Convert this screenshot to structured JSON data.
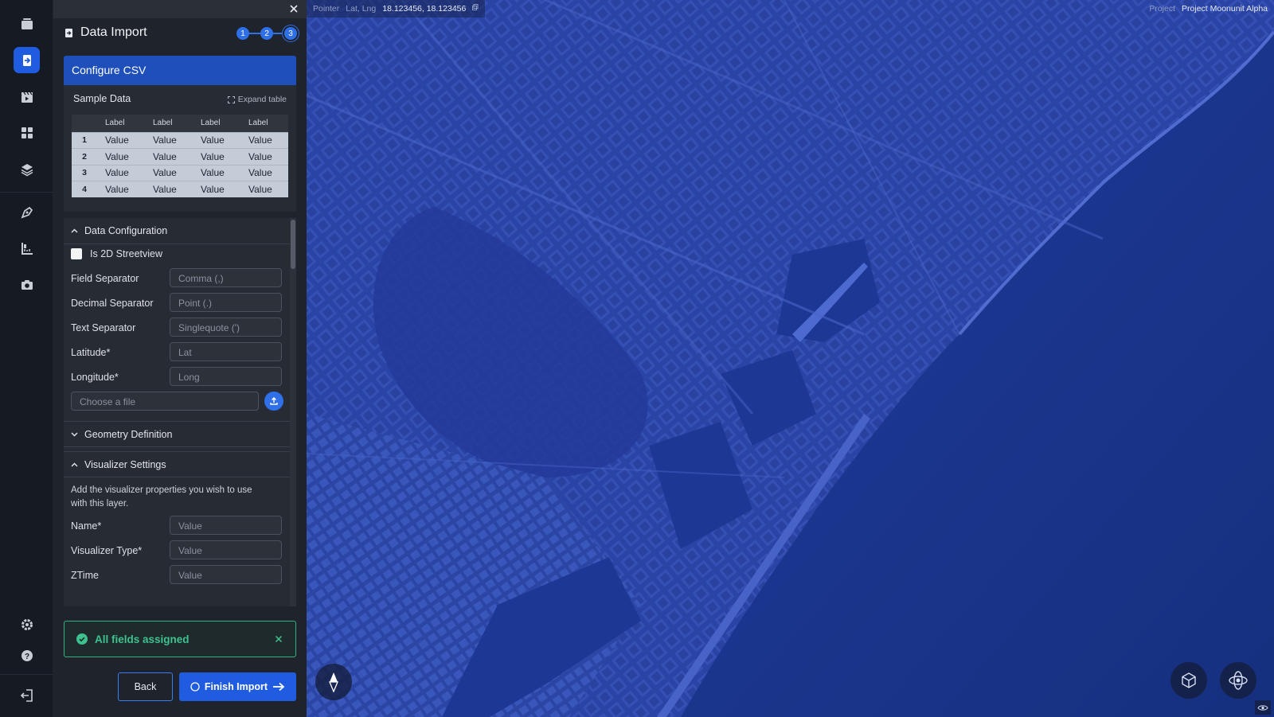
{
  "rail": {
    "items": [
      {
        "icon": "folder-stack-icon",
        "active": false
      },
      {
        "icon": "data-import-icon",
        "active": true
      },
      {
        "icon": "film-clapper-icon",
        "active": false
      },
      {
        "icon": "dashboard-grid-icon",
        "active": false
      },
      {
        "icon": "layers-icon",
        "active": false
      },
      {
        "icon": "pen-nib-icon",
        "active": false
      },
      {
        "icon": "ruler-measure-icon",
        "active": false
      },
      {
        "icon": "camera-icon",
        "active": false
      },
      {
        "icon": "gear-icon",
        "active": false
      },
      {
        "icon": "help-icon",
        "active": false
      },
      {
        "icon": "logout-icon",
        "active": false
      }
    ]
  },
  "panel": {
    "title": "Data Import",
    "steps": [
      "1",
      "2",
      "3"
    ],
    "current_step": "3",
    "configure_title": "Configure CSV",
    "sample": {
      "heading": "Sample Data",
      "expand_label": "Expand table",
      "columns": [
        "Label",
        "Label",
        "Label",
        "Label"
      ],
      "rows": [
        {
          "index": "1",
          "cells": [
            "Value",
            "Value",
            "Value",
            "Value"
          ]
        },
        {
          "index": "2",
          "cells": [
            "Value",
            "Value",
            "Value",
            "Value"
          ]
        },
        {
          "index": "3",
          "cells": [
            "Value",
            "Value",
            "Value",
            "Value"
          ]
        },
        {
          "index": "4",
          "cells": [
            "Value",
            "Value",
            "Value",
            "Value"
          ]
        }
      ]
    },
    "data_config": {
      "title": "Data Configuration",
      "streetview_label": "Is 2D Streetview",
      "streetview_checked": false,
      "fields": [
        {
          "label": "Field Separator",
          "placeholder": "Comma (,)"
        },
        {
          "label": "Decimal Separator",
          "placeholder": "Point (.)"
        },
        {
          "label": "Text Separator",
          "placeholder": "Singlequote (')"
        },
        {
          "label": "Latitude*",
          "placeholder": "Lat"
        },
        {
          "label": "Longitude*",
          "placeholder": "Long"
        }
      ],
      "file_placeholder": "Choose a file"
    },
    "geometry": {
      "title": "Geometry Definition"
    },
    "visualizer": {
      "title": "Visualizer Settings",
      "description": "Add the visualizer properties you wish to use with this layer.",
      "fields": [
        {
          "label": "Name*",
          "placeholder": "Value"
        },
        {
          "label": "Visualizer Type*",
          "placeholder": "Value"
        },
        {
          "label": "ZTime",
          "placeholder": "Value"
        }
      ]
    },
    "alert": "All fields assigned",
    "back_label": "Back",
    "finish_label": "Finish Import"
  },
  "map": {
    "pointer_label": "Pointer",
    "latlng_label": "Lat, Lng",
    "latlng_value": "18.123456, 18.123456",
    "project_label": "Project",
    "project_name": "Project Moonunit Alpha"
  },
  "colors": {
    "accent": "#1f5ce0",
    "success": "#3ec28f",
    "map_tint": "#1e3590"
  }
}
